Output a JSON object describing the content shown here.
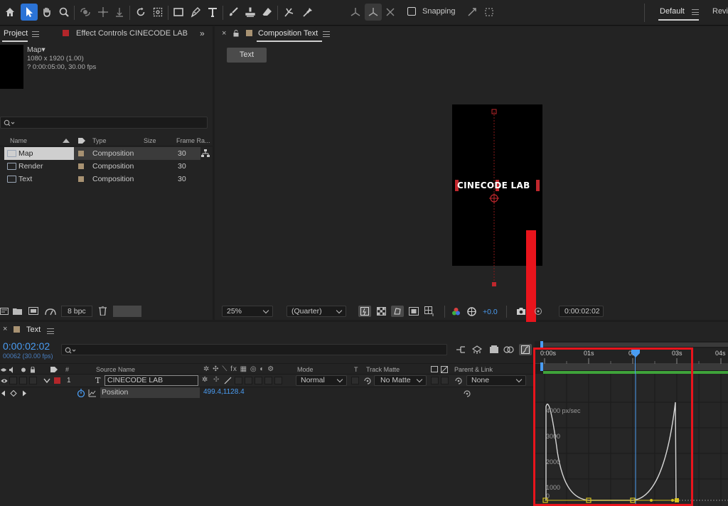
{
  "toolbar": {
    "snapping_label": "Snapping",
    "workspace_label": "Default",
    "workspace_next": "Revi"
  },
  "project_panel": {
    "tab_label": "Project",
    "effect_controls_tab": "Effect Controls CINECODE LAB",
    "selected_name": "Map▾",
    "selected_dims": "1080 x 1920 (1.00)",
    "selected_duration": "? 0:00:05:00, 30.00 fps",
    "columns": {
      "name": "Name",
      "type": "Type",
      "size": "Size",
      "frame_rate": "Frame Ra..."
    },
    "items": [
      {
        "name": "Map",
        "type": "Composition",
        "frame_rate": "30"
      },
      {
        "name": "Render",
        "type": "Composition",
        "frame_rate": "30"
      },
      {
        "name": "Text",
        "type": "Composition",
        "frame_rate": "30"
      }
    ],
    "bpc_label": "8 bpc"
  },
  "composition_panel": {
    "tab_label": "Composition Text",
    "comp_tab_button": "Text",
    "canvas_text": "CINECODE LAB",
    "zoom": "25%",
    "resolution": "(Quarter)",
    "exposure": "+0.0",
    "timecode": "0:00:02:02"
  },
  "timeline_panel": {
    "tab_label": "Text",
    "current_time": "0:00:02:02",
    "frame_info": "00062 (30.00 fps)",
    "columns": {
      "source_name": "Source Name",
      "mode": "Mode",
      "t": "T",
      "track_matte": "Track Matte",
      "parent_link": "Parent & Link"
    },
    "layer": {
      "number": "1",
      "name": "CINECODE LAB",
      "mode": "Normal",
      "track_matte": "No Matte",
      "parent": "None"
    },
    "property": {
      "name": "Position",
      "value": "499.4,1128.4"
    },
    "ruler_labels": [
      "0:00s",
      "01s",
      "02s",
      "03s",
      "04s"
    ],
    "graph_labels": [
      "4000 px/sec",
      "3000",
      "2000",
      "1000",
      "0"
    ]
  },
  "colors": {
    "accent_blue": "#2b73d6",
    "time_blue": "#4a9cf2",
    "highlight_red": "#e8141c",
    "keyframe_yellow": "#d8c31e",
    "work_area_green": "#3fa33a"
  }
}
